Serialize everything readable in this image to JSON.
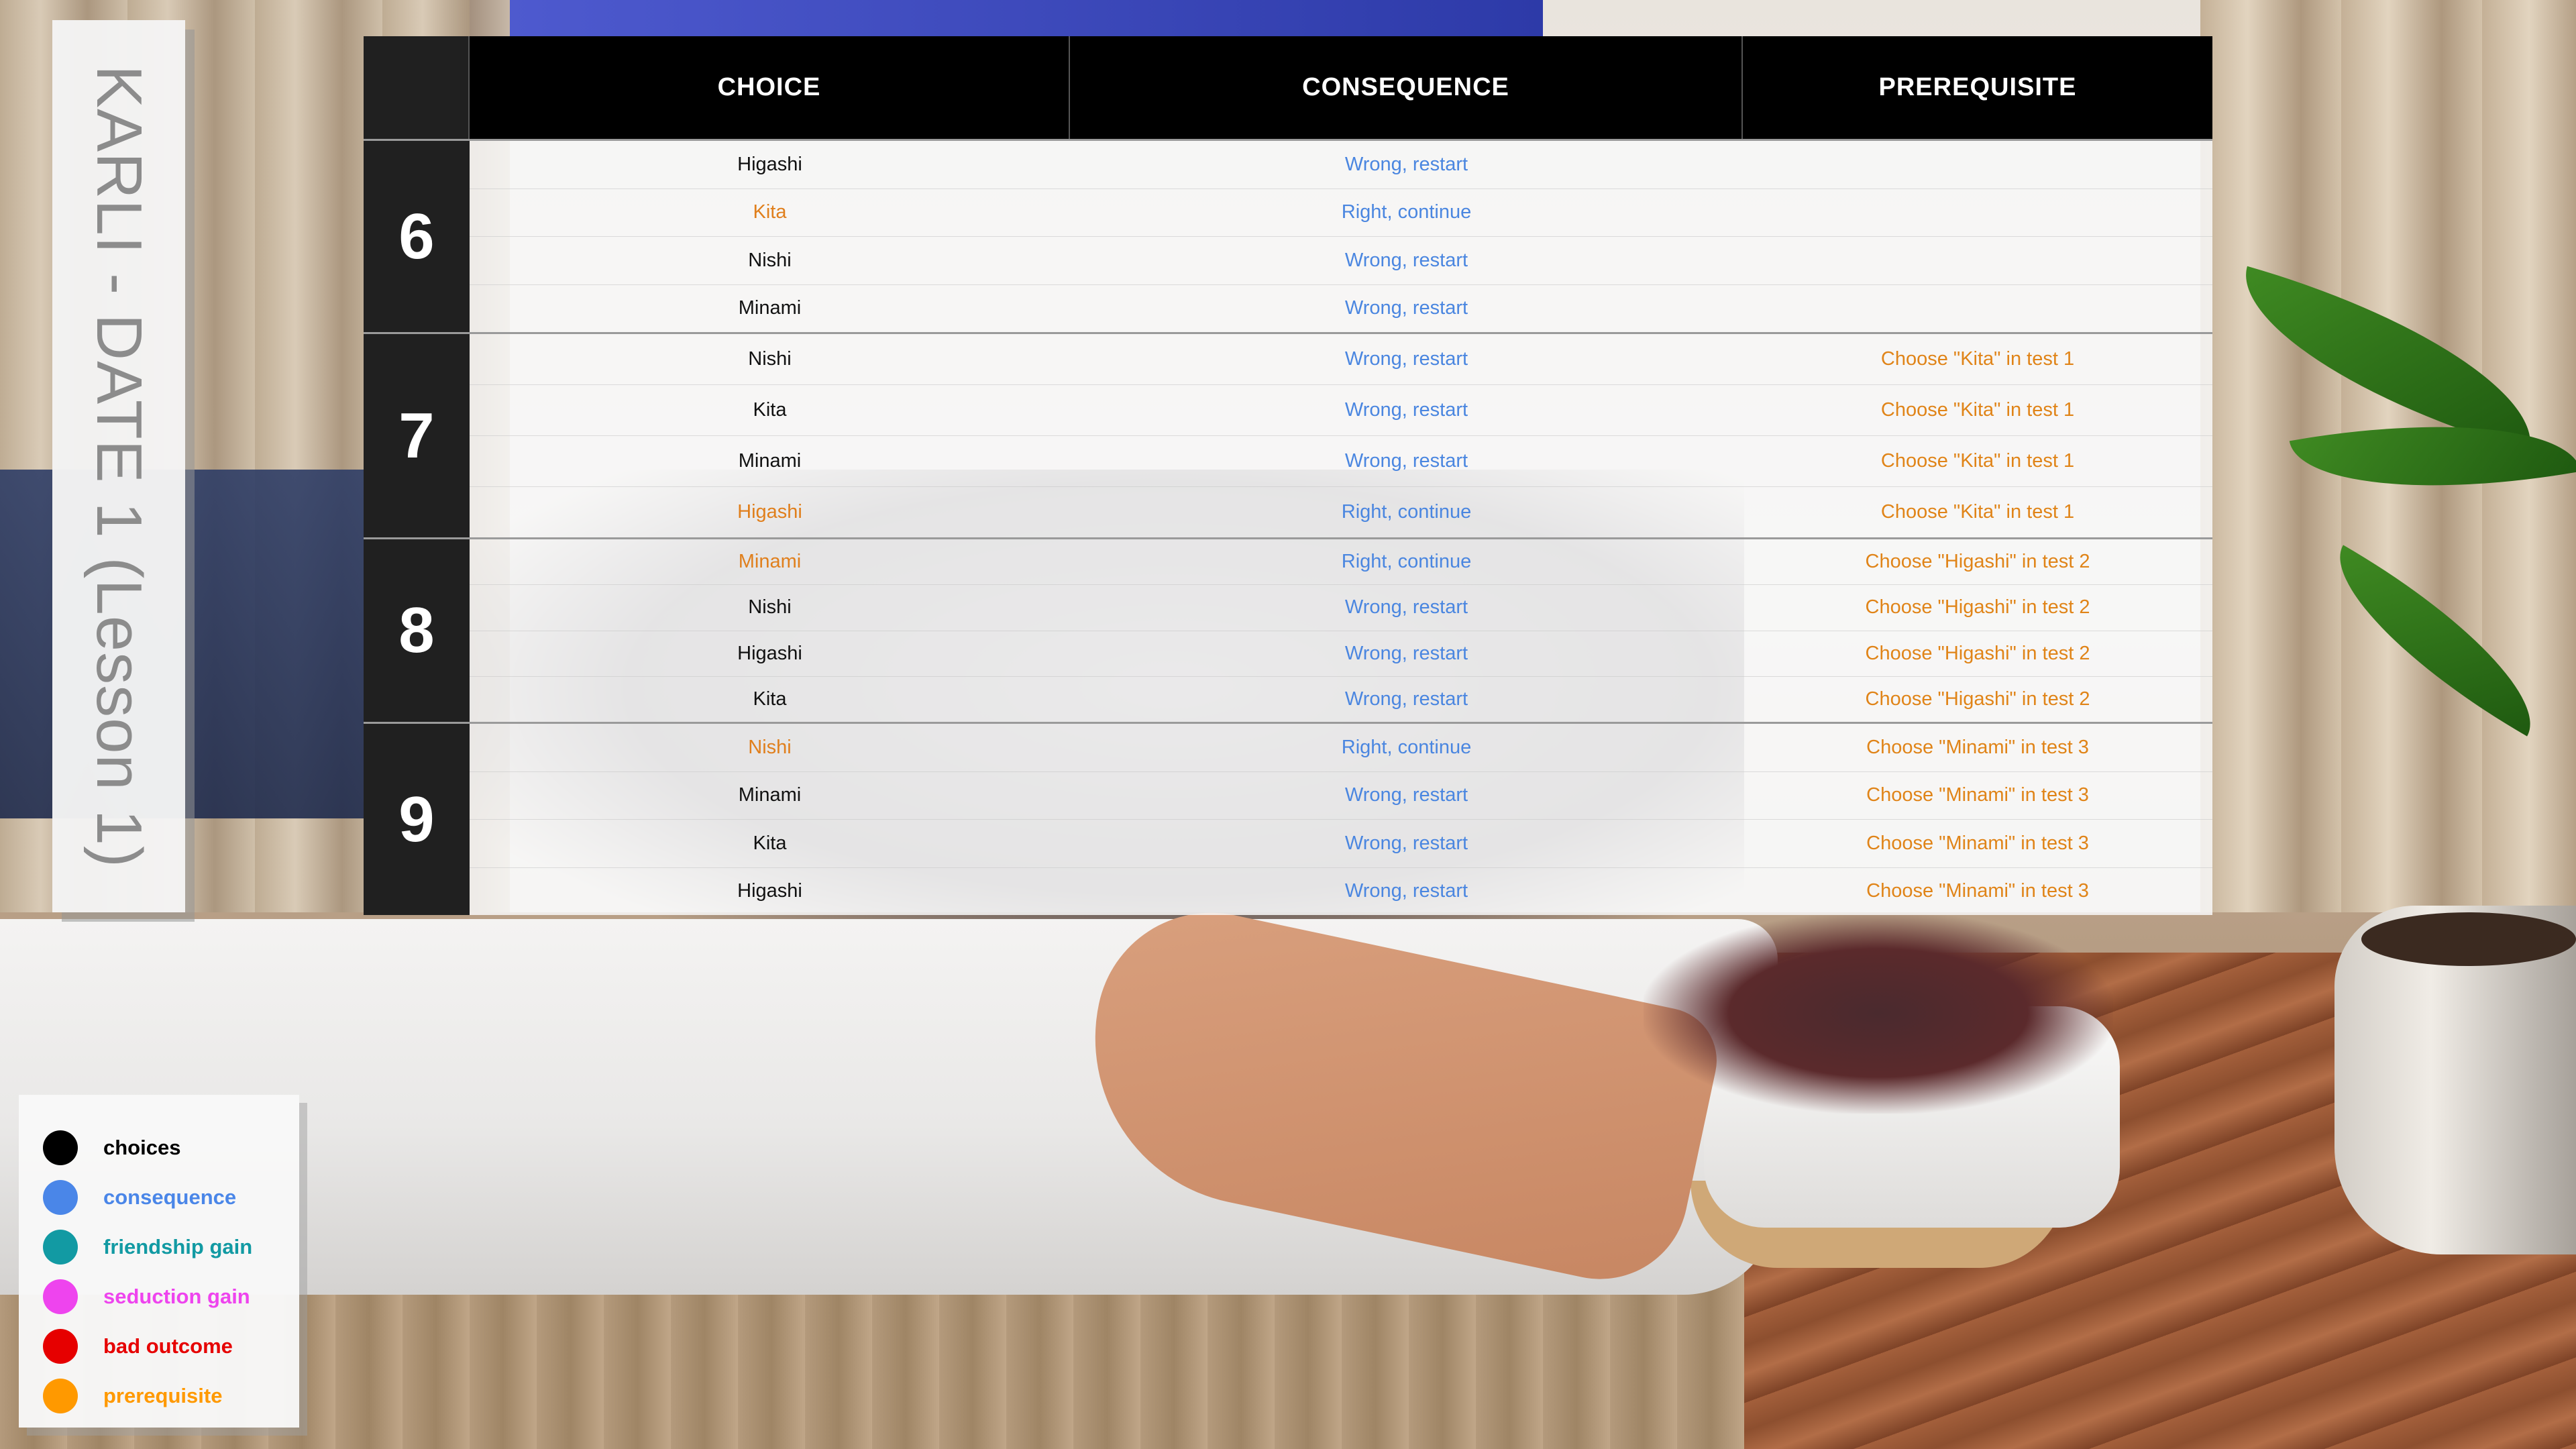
{
  "title": "KARLI - DATE 1 (Lesson 1)",
  "headers": {
    "choice": "CHOICE",
    "consequence": "CONSEQUENCE",
    "prerequisite": "PREREQUISITE"
  },
  "groups": [
    {
      "number": "6",
      "rows": [
        {
          "choice": "Higashi",
          "consequence": "Wrong, restart",
          "prerequisite": ""
        },
        {
          "choice": "Kita",
          "consequence": "Right, continue",
          "prerequisite": ""
        },
        {
          "choice": "Nishi",
          "consequence": "Wrong, restart",
          "prerequisite": ""
        },
        {
          "choice": "Minami",
          "consequence": "Wrong, restart",
          "prerequisite": ""
        }
      ]
    },
    {
      "number": "7",
      "rows": [
        {
          "choice": "Nishi",
          "consequence": "Wrong, restart",
          "prerequisite": "Choose \"Kita\" in test 1"
        },
        {
          "choice": "Kita",
          "consequence": "Wrong, restart",
          "prerequisite": "Choose \"Kita\" in test 1"
        },
        {
          "choice": "Minami",
          "consequence": "Wrong, restart",
          "prerequisite": "Choose \"Kita\" in test 1"
        },
        {
          "choice": "Higashi",
          "consequence": "Right, continue",
          "prerequisite": "Choose \"Kita\" in test 1"
        }
      ]
    },
    {
      "number": "8",
      "rows": [
        {
          "choice": "Minami",
          "consequence": "Right, continue",
          "prerequisite": "Choose \"Higashi\" in test 2"
        },
        {
          "choice": "Nishi",
          "consequence": "Wrong, restart",
          "prerequisite": "Choose \"Higashi\" in test 2"
        },
        {
          "choice": "Higashi",
          "consequence": "Wrong, restart",
          "prerequisite": "Choose \"Higashi\" in test 2"
        },
        {
          "choice": "Kita",
          "consequence": "Wrong, restart",
          "prerequisite": "Choose \"Higashi\" in test 2"
        }
      ]
    },
    {
      "number": "9",
      "rows": [
        {
          "choice": "Nishi",
          "consequence": "Right, continue",
          "prerequisite": "Choose \"Minami\" in test 3"
        },
        {
          "choice": "Minami",
          "consequence": "Wrong, restart",
          "prerequisite": "Choose \"Minami\" in test 3"
        },
        {
          "choice": "Kita",
          "consequence": "Wrong, restart",
          "prerequisite": "Choose \"Minami\" in test 3"
        },
        {
          "choice": "Higashi",
          "consequence": "Wrong, restart",
          "prerequisite": "Choose \"Minami\" in test 3"
        }
      ]
    }
  ],
  "legend": [
    {
      "label": "choices",
      "color": "#000000"
    },
    {
      "label": "consequence",
      "color": "#4a86e8"
    },
    {
      "label": "friendship gain",
      "color": "#129aa3"
    },
    {
      "label": "seduction gain",
      "color": "#ee44ee"
    },
    {
      "label": "bad outcome",
      "color": "#e60000"
    },
    {
      "label": "prerequisite",
      "color": "#ff9900"
    }
  ],
  "colors": {
    "right_choice": "#e07f1c",
    "consequence_text": "#4a86e0",
    "prerequisite_text": "#e08418"
  }
}
